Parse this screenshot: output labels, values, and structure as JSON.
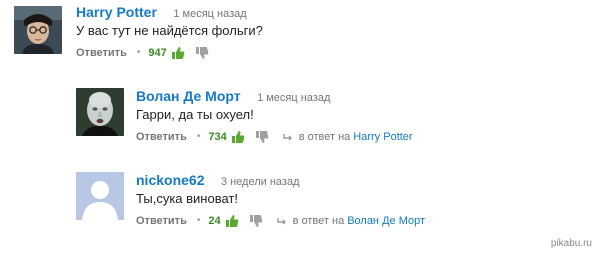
{
  "comments": [
    {
      "author": "Harry Potter",
      "time": "1 месяц назад",
      "text": "У вас тут не найдётся фольги?",
      "reply_label": "Ответить",
      "likes": "947",
      "reply_to_prefix": "",
      "reply_to": "",
      "avatar_icon": "harry-potter-avatar"
    },
    {
      "author": "Волан Де Морт",
      "time": "1 месяц назад",
      "text": "Гарри, да ты охуел!",
      "reply_label": "Ответить",
      "likes": "734",
      "reply_to_prefix": "в ответ на",
      "reply_to": "Harry Potter",
      "avatar_icon": "voldemort-avatar"
    },
    {
      "author": "nickone62",
      "time": "3 недели назад",
      "text": "Ты,сука виноват!",
      "reply_label": "Ответить",
      "likes": "24",
      "reply_to_prefix": "в ответ на",
      "reply_to": "Волан Де Морт",
      "avatar_icon": "default-user-avatar"
    }
  ],
  "watermark": "pikabu.ru",
  "colors": {
    "author": "#167ac6",
    "likes": "#3b8a24",
    "muted": "#767676",
    "default_avatar_bg": "#b8c8e4"
  }
}
